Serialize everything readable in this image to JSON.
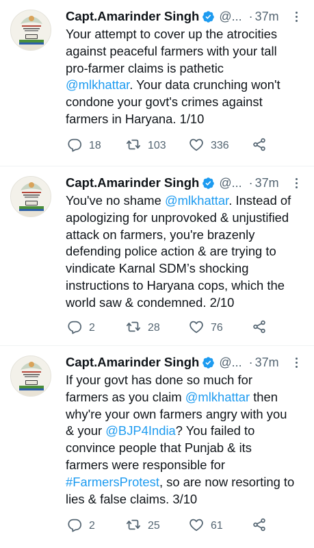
{
  "tweets": [
    {
      "name": "Capt.Amarinder Singh",
      "handle": "@...",
      "separator": "·",
      "time": "37m",
      "lines": [
        [
          {
            "t": "Your attempt to cover up the atrocities"
          }
        ],
        [
          {
            "t": "against peaceful farmers with your tall"
          }
        ],
        [
          {
            "t": "pro-farmer claims is pathetic"
          }
        ],
        [
          {
            "t": "@mlkhattar",
            "link": true
          },
          {
            "t": ". Your data crunching won't"
          }
        ],
        [
          {
            "t": "condone your govt's crimes against"
          }
        ],
        [
          {
            "t": "farmers in Haryana. 1/10"
          }
        ]
      ],
      "replies": "18",
      "retweets": "103",
      "likes": "336"
    },
    {
      "name": "Capt.Amarinder Singh",
      "handle": "@...",
      "separator": "·",
      "time": "37m",
      "lines": [
        [
          {
            "t": "You've no shame "
          },
          {
            "t": "@mlkhattar",
            "link": true
          },
          {
            "t": ". Instead of"
          }
        ],
        [
          {
            "t": "apologizing for unprovoked & unjustified"
          }
        ],
        [
          {
            "t": "attack on farmers, you're brazenly"
          }
        ],
        [
          {
            "t": "defending police action & are trying to"
          }
        ],
        [
          {
            "t": "vindicate Karnal SDM’s shocking"
          }
        ],
        [
          {
            "t": "instructions to Haryana cops, which the"
          }
        ],
        [
          {
            "t": "world saw & condemned. 2/10"
          }
        ]
      ],
      "replies": "2",
      "retweets": "28",
      "likes": "76"
    },
    {
      "name": "Capt.Amarinder Singh",
      "handle": "@...",
      "separator": "·",
      "time": "37m",
      "lines": [
        [
          {
            "t": "If your govt has done so much for"
          }
        ],
        [
          {
            "t": "farmers as you claim "
          },
          {
            "t": "@mlkhattar",
            "link": true
          },
          {
            "t": " then"
          }
        ],
        [
          {
            "t": "why're your own farmers angry with you"
          }
        ],
        [
          {
            "t": "& your "
          },
          {
            "t": "@BJP4India",
            "link": true
          },
          {
            "t": "? You failed to"
          }
        ],
        [
          {
            "t": "convince people that Punjab & its"
          }
        ],
        [
          {
            "t": "farmers were responsible for"
          }
        ],
        [
          {
            "t": "#FarmersProtest",
            "link": true
          },
          {
            "t": ", so are now resorting to"
          }
        ],
        [
          {
            "t": "lies & false claims. 3/10"
          }
        ]
      ],
      "replies": "2",
      "retweets": "25",
      "likes": "61"
    }
  ],
  "icons": {
    "verified": "verified-badge-icon",
    "more": "more-options-icon",
    "reply": "reply-icon",
    "retweet": "retweet-icon",
    "like": "like-icon",
    "share": "share-icon"
  },
  "colors": {
    "link": "#1d9bf0",
    "verified": "#1d9bf0",
    "secondary": "#536471",
    "text": "#0f1419"
  }
}
